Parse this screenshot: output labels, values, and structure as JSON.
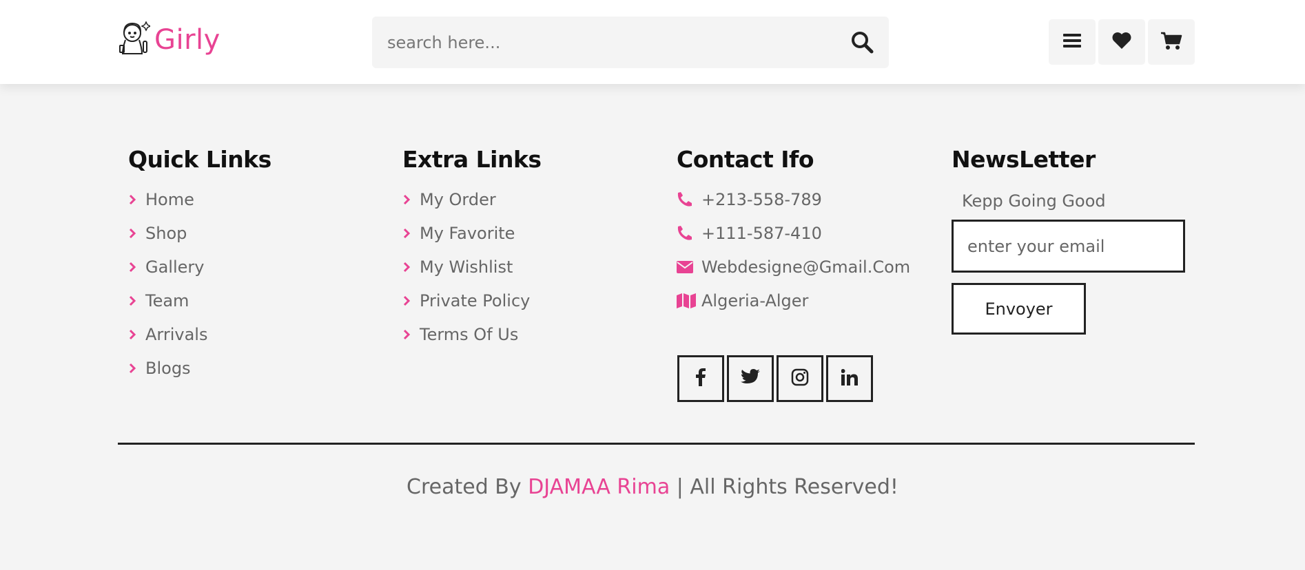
{
  "colors": {
    "accent": "#e84393",
    "text_muted": "#666666",
    "dark": "#222222",
    "background": "#f4f4f4"
  },
  "header": {
    "logo_text": "Girly",
    "search": {
      "placeholder": "search here...",
      "icon": "search-icon"
    },
    "icons": [
      "menu-icon",
      "heart-icon",
      "cart-icon"
    ]
  },
  "footer": {
    "quick_links": {
      "title": "Quick Links",
      "items": [
        "Home",
        "Shop",
        "Gallery",
        "Team",
        "Arrivals",
        "Blogs"
      ]
    },
    "extra_links": {
      "title": "Extra Links",
      "items": [
        "My Order",
        "My Favorite",
        "My Wishlist",
        "Private Policy",
        "Terms Of Us"
      ]
    },
    "contact": {
      "title": "Contact Ifo",
      "phone1": "+213-558-789",
      "phone2": "+111-587-410",
      "email": "Webdesigne@Gmail.Com",
      "address": "Algeria-Alger",
      "socials": [
        "facebook-icon",
        "twitter-icon",
        "instagram-icon",
        "linkedin-icon"
      ]
    },
    "newsletter": {
      "title": "NewsLetter",
      "subtitle": "Kepp Going Good",
      "email_placeholder": "enter your email",
      "button_label": "Envoyer"
    },
    "credit": {
      "prefix": "Created By",
      "author": "DJAMAA Rima",
      "suffix": "| All Rights Reserved!"
    }
  }
}
